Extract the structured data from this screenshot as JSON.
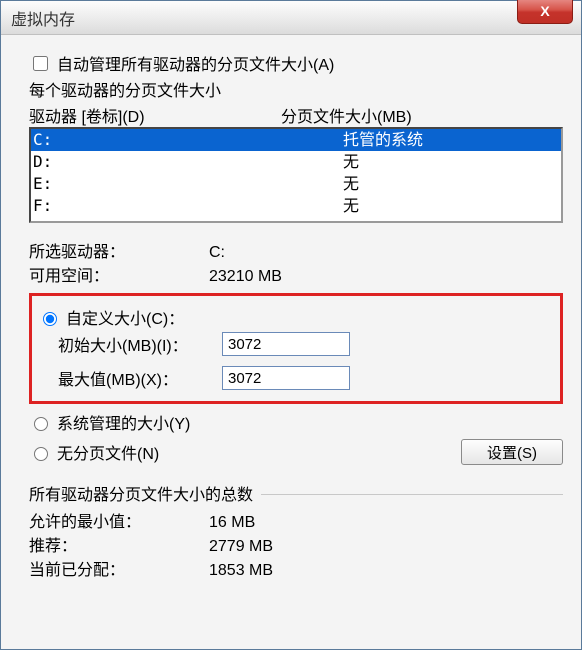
{
  "window": {
    "title": "虚拟内存",
    "close_glyph": "X"
  },
  "auto_manage": {
    "label": "自动管理所有驱动器的分页文件大小(A)",
    "checked": false
  },
  "per_drive_heading": "每个驱动器的分页文件大小",
  "list_header": {
    "col1": "驱动器  [卷标](D)",
    "col2": "分页文件大小(MB)"
  },
  "drives": [
    {
      "drive": "C:",
      "paging": "托管的系统",
      "selected": true
    },
    {
      "drive": "D:",
      "paging": "无",
      "selected": false
    },
    {
      "drive": "E:",
      "paging": "无",
      "selected": false
    },
    {
      "drive": "F:",
      "paging": "无",
      "selected": false
    }
  ],
  "selected_info": {
    "drive_label": "所选驱动器：",
    "drive_value": "C:",
    "free_label": "可用空间：",
    "free_value": "23210 MB"
  },
  "size_mode": "custom",
  "custom": {
    "radio_label": "自定义大小(C)：",
    "initial_label": "初始大小(MB)(I)：",
    "initial_value": "3072",
    "max_label": "最大值(MB)(X)：",
    "max_value": "3072"
  },
  "system_managed_label": "系统管理的大小(Y)",
  "no_paging_label": "无分页文件(N)",
  "set_button": "设置(S)",
  "totals": {
    "heading": "所有驱动器分页文件大小的总数",
    "min_label": "允许的最小值：",
    "min_value": "16 MB",
    "rec_label": "推荐：",
    "rec_value": "2779 MB",
    "cur_label": "当前已分配：",
    "cur_value": "1853 MB"
  }
}
